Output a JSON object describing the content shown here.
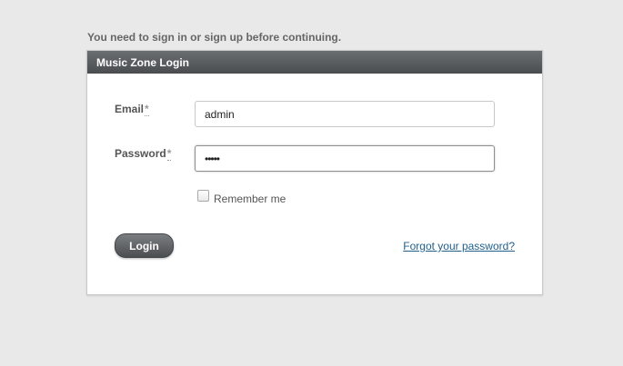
{
  "flash": {
    "message": "You need to sign in or sign up before continuing."
  },
  "panel": {
    "title": "Music Zone Login"
  },
  "form": {
    "email_label": "Email",
    "email_value": "admin",
    "password_label": "Password",
    "password_value": "•••••",
    "required_marker": "*",
    "remember_label": "Remember me",
    "remember_checked": false,
    "submit_label": "Login",
    "forgot_link": "Forgot your password?"
  },
  "colors": {
    "background": "#e9e9e9",
    "header": "#555a5e",
    "link": "#1f5f8b"
  }
}
